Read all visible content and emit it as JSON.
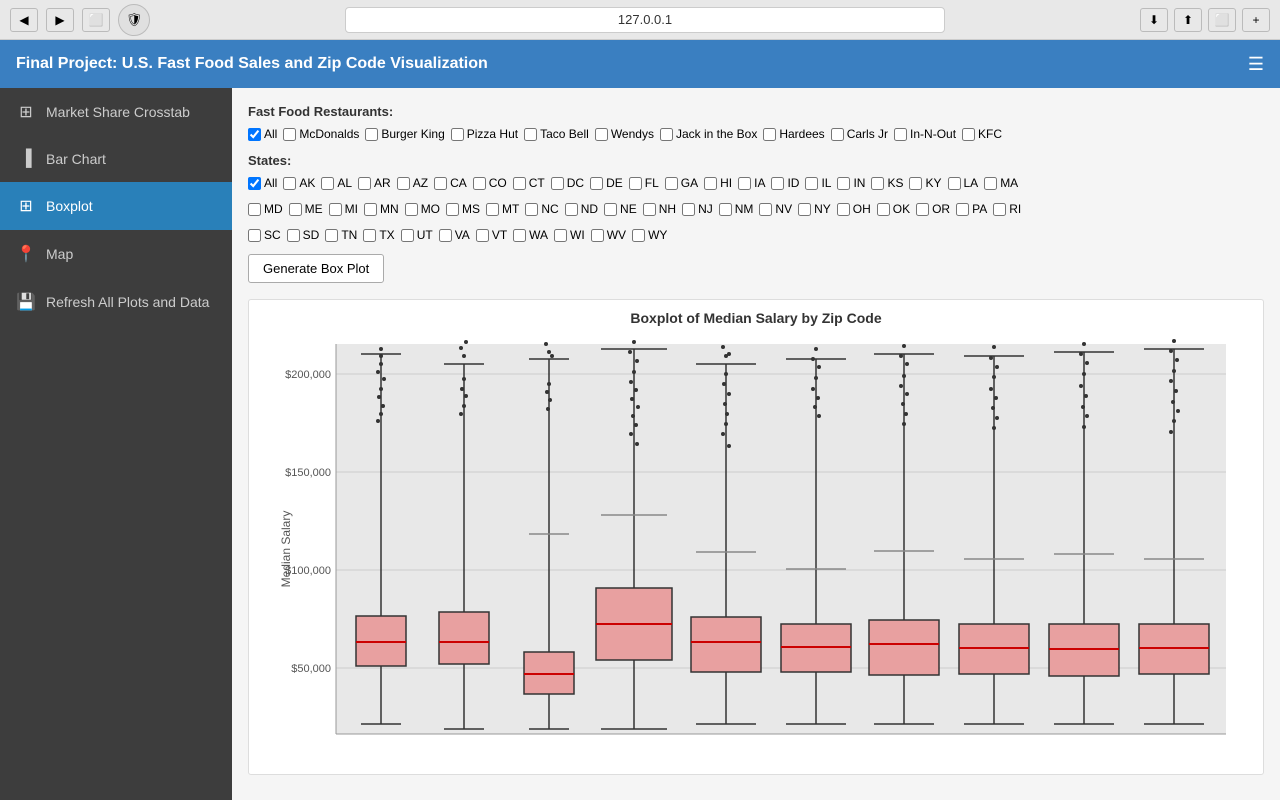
{
  "browser": {
    "url": "127.0.0.1",
    "back_label": "◀",
    "forward_label": "▶",
    "reload_label": "↻",
    "new_tab_label": "+"
  },
  "header": {
    "title": "Final Project: U.S. Fast Food Sales and Zip Code Visualization",
    "menu_icon": "☰"
  },
  "sidebar": {
    "items": [
      {
        "id": "market-share-crosstab",
        "label": "Market Share Crosstab",
        "icon": "⊞"
      },
      {
        "id": "bar-chart",
        "label": "Bar Chart",
        "icon": "📊"
      },
      {
        "id": "boxplot",
        "label": "Boxplot",
        "icon": "⊞",
        "active": true
      },
      {
        "id": "map",
        "label": "Map",
        "icon": "📍"
      },
      {
        "id": "refresh",
        "label": "Refresh All Plots and Data",
        "icon": "💾"
      }
    ]
  },
  "filters": {
    "restaurants_label": "Fast Food Restaurants:",
    "states_label": "States:",
    "restaurants": [
      {
        "id": "all",
        "label": "All",
        "checked": true
      },
      {
        "id": "mcdonalds",
        "label": "McDonalds",
        "checked": false
      },
      {
        "id": "burger-king",
        "label": "Burger King",
        "checked": false
      },
      {
        "id": "pizza-hut",
        "label": "Pizza Hut",
        "checked": false
      },
      {
        "id": "taco-bell",
        "label": "Taco Bell",
        "checked": false
      },
      {
        "id": "wendys",
        "label": "Wendys",
        "checked": false
      },
      {
        "id": "jack-in-the-box",
        "label": "Jack in the Box",
        "checked": false
      },
      {
        "id": "hardees",
        "label": "Hardees",
        "checked": false
      },
      {
        "id": "carls-jr",
        "label": "Carls Jr",
        "checked": false
      },
      {
        "id": "in-n-out",
        "label": "In-N-Out",
        "checked": false
      },
      {
        "id": "kfc",
        "label": "KFC",
        "checked": false
      }
    ],
    "states_row1": [
      {
        "id": "all",
        "label": "All",
        "checked": true
      },
      {
        "id": "ak",
        "label": "AK",
        "checked": false
      },
      {
        "id": "al",
        "label": "AL",
        "checked": false
      },
      {
        "id": "ar",
        "label": "AR",
        "checked": false
      },
      {
        "id": "az",
        "label": "AZ",
        "checked": false
      },
      {
        "id": "ca",
        "label": "CA",
        "checked": false
      },
      {
        "id": "co",
        "label": "CO",
        "checked": false
      },
      {
        "id": "ct",
        "label": "CT",
        "checked": false
      },
      {
        "id": "dc",
        "label": "DC",
        "checked": false
      },
      {
        "id": "de",
        "label": "DE",
        "checked": false
      },
      {
        "id": "fl",
        "label": "FL",
        "checked": false
      },
      {
        "id": "ga",
        "label": "GA",
        "checked": false
      },
      {
        "id": "hi",
        "label": "HI",
        "checked": false
      },
      {
        "id": "ia",
        "label": "IA",
        "checked": false
      },
      {
        "id": "id",
        "label": "ID",
        "checked": false
      },
      {
        "id": "il",
        "label": "IL",
        "checked": false
      },
      {
        "id": "in",
        "label": "IN",
        "checked": false
      },
      {
        "id": "ks",
        "label": "KS",
        "checked": false
      },
      {
        "id": "ky",
        "label": "KY",
        "checked": false
      },
      {
        "id": "la",
        "label": "LA",
        "checked": false
      },
      {
        "id": "ma",
        "label": "MA",
        "checked": false
      }
    ],
    "states_row2": [
      {
        "id": "md",
        "label": "MD",
        "checked": false
      },
      {
        "id": "me",
        "label": "ME",
        "checked": false
      },
      {
        "id": "mi",
        "label": "MI",
        "checked": false
      },
      {
        "id": "mn",
        "label": "MN",
        "checked": false
      },
      {
        "id": "mo",
        "label": "MO",
        "checked": false
      },
      {
        "id": "ms",
        "label": "MS",
        "checked": false
      },
      {
        "id": "mt",
        "label": "MT",
        "checked": false
      },
      {
        "id": "nc",
        "label": "NC",
        "checked": false
      },
      {
        "id": "nd",
        "label": "ND",
        "checked": false
      },
      {
        "id": "ne",
        "label": "NE",
        "checked": false
      },
      {
        "id": "nh",
        "label": "NH",
        "checked": false
      },
      {
        "id": "nj",
        "label": "NJ",
        "checked": false
      },
      {
        "id": "nm",
        "label": "NM",
        "checked": false
      },
      {
        "id": "nv",
        "label": "NV",
        "checked": false
      },
      {
        "id": "ny",
        "label": "NY",
        "checked": false
      },
      {
        "id": "oh",
        "label": "OH",
        "checked": false
      },
      {
        "id": "ok",
        "label": "OK",
        "checked": false
      },
      {
        "id": "or",
        "label": "OR",
        "checked": false
      },
      {
        "id": "pa",
        "label": "PA",
        "checked": false
      },
      {
        "id": "ri",
        "label": "RI",
        "checked": false
      }
    ],
    "states_row3": [
      {
        "id": "sc",
        "label": "SC",
        "checked": false
      },
      {
        "id": "sd",
        "label": "SD",
        "checked": false
      },
      {
        "id": "tn",
        "label": "TN",
        "checked": false
      },
      {
        "id": "tx",
        "label": "TX",
        "checked": false
      },
      {
        "id": "ut",
        "label": "UT",
        "checked": false
      },
      {
        "id": "va",
        "label": "VA",
        "checked": false
      },
      {
        "id": "vt",
        "label": "VT",
        "checked": false
      },
      {
        "id": "wa",
        "label": "WA",
        "checked": false
      },
      {
        "id": "wi",
        "label": "WI",
        "checked": false
      },
      {
        "id": "wv",
        "label": "WV",
        "checked": false
      },
      {
        "id": "wy",
        "label": "WY",
        "checked": false
      }
    ]
  },
  "chart": {
    "title": "Boxplot of Median Salary by Zip Code",
    "y_axis_label": "Median Salary",
    "generate_btn_label": "Generate Box Plot",
    "y_ticks": [
      "$200,000",
      "$150,000",
      "$100,000",
      "$50,000"
    ],
    "colors": {
      "box_fill": "#e8a0a0",
      "box_stroke": "#333",
      "whisker": "#333",
      "median": "#c00",
      "outlier": "#222",
      "grid": "#ddd",
      "bg": "#e8e8e8"
    }
  }
}
